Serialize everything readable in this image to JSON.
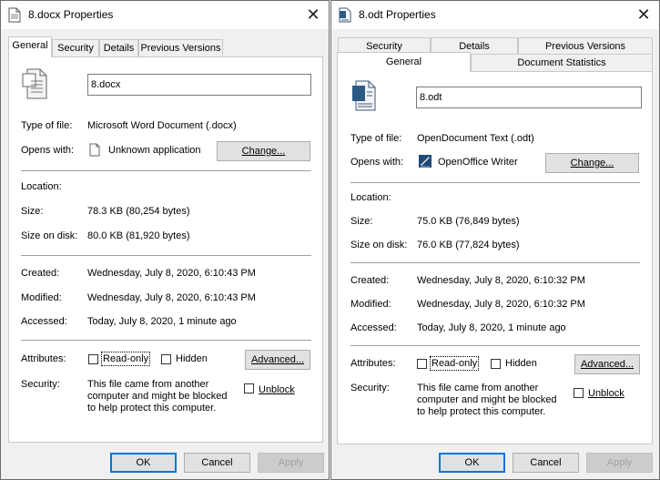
{
  "left": {
    "title": "8.docx Properties",
    "tabs": [
      "General",
      "Security",
      "Details",
      "Previous Versions"
    ],
    "file_name": "8.docx",
    "type_label": "Type of file:",
    "type_value": "Microsoft Word Document (.docx)",
    "opens_label": "Opens with:",
    "opens_value": "Unknown application",
    "change_label": "Change...",
    "location_label": "Location:",
    "location_value": "",
    "size_label": "Size:",
    "size_value": "78.3 KB (80,254 bytes)",
    "size_disk_label": "Size on disk:",
    "size_disk_value": "80.0 KB (81,920 bytes)",
    "created_label": "Created:",
    "created_value": "Wednesday, July 8, 2020, 6:10:43 PM",
    "modified_label": "Modified:",
    "modified_value": "Wednesday, July 8, 2020, 6:10:43 PM",
    "accessed_label": "Accessed:",
    "accessed_value": "Today, July 8, 2020, 1 minute ago",
    "attributes_label": "Attributes:",
    "readonly_label": "Read-only",
    "hidden_label": "Hidden",
    "advanced_label": "Advanced...",
    "security_label": "Security:",
    "security_text": "This file came from another computer and might be blocked to help protect this computer.",
    "unblock_label": "Unblock",
    "ok_label": "OK",
    "cancel_label": "Cancel",
    "apply_label": "Apply"
  },
  "right": {
    "title": "8.odt Properties",
    "tabs_row1": [
      "Security",
      "Details",
      "Previous Versions"
    ],
    "tabs_row2": [
      "General",
      "Document Statistics"
    ],
    "file_name": "8.odt",
    "type_label": "Type of file:",
    "type_value": "OpenDocument Text (.odt)",
    "opens_label": "Opens with:",
    "opens_value": "OpenOffice Writer",
    "change_label": "Change...",
    "location_label": "Location:",
    "location_value": "",
    "size_label": "Size:",
    "size_value": "75.0 KB (76,849 bytes)",
    "size_disk_label": "Size on disk:",
    "size_disk_value": "76.0 KB (77,824 bytes)",
    "created_label": "Created:",
    "created_value": "Wednesday, July 8, 2020, 6:10:32 PM",
    "modified_label": "Modified:",
    "modified_value": "Wednesday, July 8, 2020, 6:10:32 PM",
    "accessed_label": "Accessed:",
    "accessed_value": "Today, July 8, 2020, 1 minute ago",
    "attributes_label": "Attributes:",
    "readonly_label": "Read-only",
    "hidden_label": "Hidden",
    "advanced_label": "Advanced...",
    "security_label": "Security:",
    "security_text": "This file came from another computer and might be blocked to help protect this computer.",
    "unblock_label": "Unblock",
    "ok_label": "OK",
    "cancel_label": "Cancel",
    "apply_label": "Apply"
  },
  "colors": {
    "dialog_bg": "#f0f0f0",
    "panel_bg": "#ffffff",
    "accent": "#0078d7",
    "disabled_text": "#a0a0a0"
  },
  "icons": {
    "left_title": "document-icon",
    "left_file": "docx-file-icon",
    "left_app": "blank-page-icon",
    "right_title": "odt-file-icon",
    "right_file": "odt-file-icon",
    "right_app": "openoffice-writer-icon",
    "close": "close-icon"
  }
}
